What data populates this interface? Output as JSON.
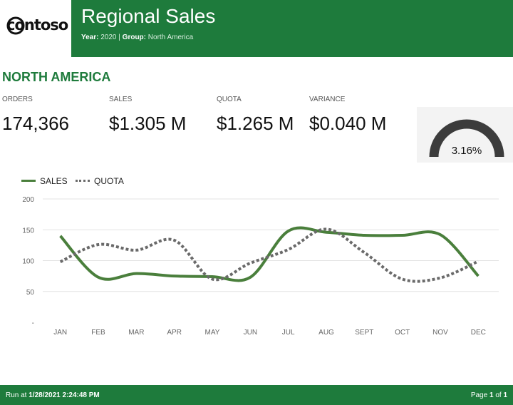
{
  "header": {
    "logo_text": "contoso",
    "title": "Regional Sales",
    "filters": [
      {
        "label": "Year:",
        "value": "2020"
      },
      {
        "label": "Group:",
        "value": "North America"
      }
    ],
    "separator": "|"
  },
  "region": "NORTH AMERICA",
  "kpis": [
    {
      "label": "ORDERS",
      "value": "174,366"
    },
    {
      "label": "SALES",
      "value": "$1.305 M"
    },
    {
      "label": "QUOTA",
      "value": "$1.265 M"
    },
    {
      "label": "VARIANCE",
      "value": "$0.040 M"
    }
  ],
  "gauge": {
    "text": "3.16%",
    "value": 3.16,
    "color": "#3c3c3c"
  },
  "colors": {
    "brand": "#1e7b3c",
    "sales": "#4a7f3c",
    "quota": "#6a6a6a",
    "grid": "#e3e3e3"
  },
  "chart_data": {
    "type": "line",
    "categories": [
      "JAN",
      "FEB",
      "MAR",
      "APR",
      "MAY",
      "JUN",
      "JUL",
      "AUG",
      "SEPT",
      "OCT",
      "NOV",
      "DEC"
    ],
    "series": [
      {
        "name": "SALES",
        "values": [
          140,
          73,
          79,
          75,
          74,
          73,
          148,
          146,
          141,
          141,
          142,
          75
        ]
      },
      {
        "name": "QUOTA",
        "values": [
          98,
          126,
          117,
          133,
          70,
          96,
          118,
          151,
          113,
          70,
          72,
          99
        ]
      }
    ],
    "yticks": [
      "200",
      "150",
      "100",
      "50",
      "-"
    ],
    "ylim": [
      0,
      200
    ],
    "legend": "top-left",
    "grid": true
  },
  "footer": {
    "run_prefix": "Run at",
    "run_time": "1/28/2021 2:24:48 PM",
    "page_prefix": "Page",
    "page_current": "1",
    "page_of": "of",
    "page_total": "1"
  }
}
